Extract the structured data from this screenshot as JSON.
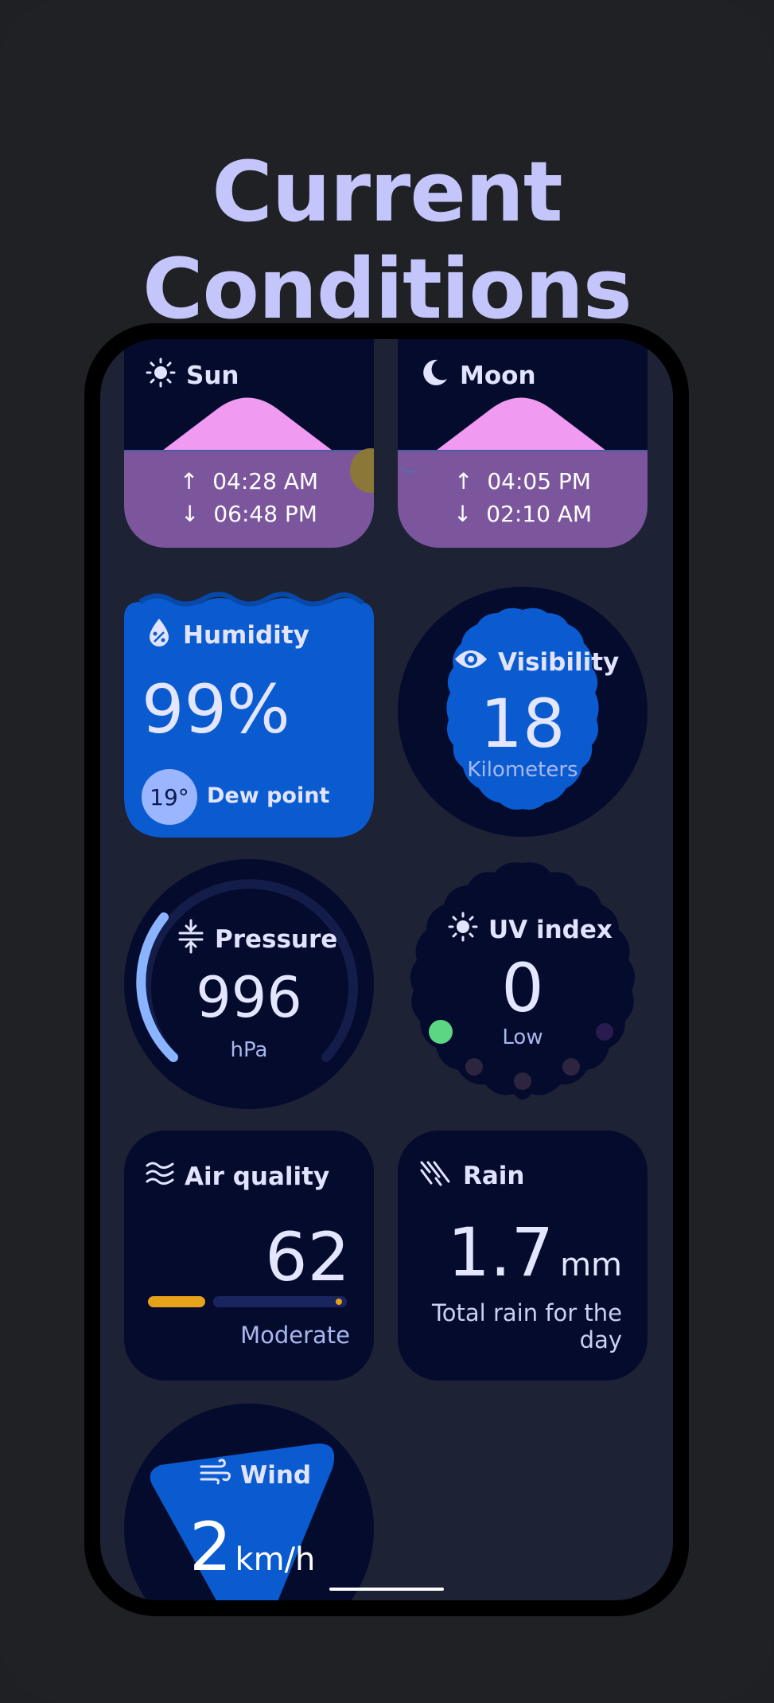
{
  "page_title": "Current Conditions",
  "sun": {
    "label": "Sun",
    "rise": "04:28 AM",
    "set": "06:48 PM",
    "rise_arrow": "↑",
    "set_arrow": "↓"
  },
  "moon": {
    "label": "Moon",
    "rise": "04:05 PM",
    "set": "02:10 AM",
    "rise_arrow": "↑",
    "set_arrow": "↓"
  },
  "humidity": {
    "label": "Humidity",
    "value": "99%",
    "dew_point_value": "19°",
    "dew_point_label": "Dew point"
  },
  "visibility": {
    "label": "Visibility",
    "value": "18",
    "unit": "Kilometers"
  },
  "pressure": {
    "label": "Pressure",
    "value": "996",
    "unit": "hPa"
  },
  "uv_index": {
    "label": "UV index",
    "value": "0",
    "level": "Low"
  },
  "air_quality": {
    "label": "Air quality",
    "value": "62",
    "level": "Moderate"
  },
  "rain": {
    "label": "Rain",
    "value": "1.7",
    "unit": "mm",
    "caption_line1": "Total rain for the",
    "caption_line2": "day"
  },
  "wind": {
    "label": "Wind",
    "value": "2",
    "unit": "km/h"
  },
  "colors": {
    "background": "#1f2124",
    "title": "#c4c6fb",
    "card": "#050b2c",
    "accent_blue": "#0a5bd0",
    "pink": "#f09af1",
    "purple": "#7c569d",
    "amber": "#e6a21a",
    "green": "#5cd683"
  },
  "icons": {
    "sun": "sun-icon",
    "moon": "moon-icon",
    "humidity": "water-drop-percent-icon",
    "visibility": "eye-icon",
    "pressure": "compress-icon",
    "uv": "sun-icon",
    "air": "air-waves-icon",
    "rain": "rain-streaks-icon",
    "wind": "wind-icon"
  }
}
